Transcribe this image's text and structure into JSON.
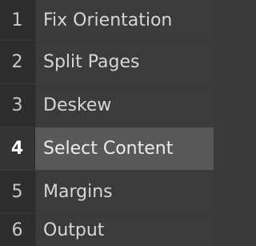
{
  "stages": {
    "selected_index": 3,
    "items": [
      {
        "number": "1",
        "label": "Fix Orientation"
      },
      {
        "number": "2",
        "label": "Split Pages"
      },
      {
        "number": "3",
        "label": "Deskew"
      },
      {
        "number": "4",
        "label": "Select Content"
      },
      {
        "number": "5",
        "label": "Margins"
      },
      {
        "number": "6",
        "label": "Output"
      }
    ]
  },
  "colors": {
    "background": "#3a3a3a",
    "number_column": "#2e2e2e",
    "selected_row": "#585858",
    "text": "#d6d6d6"
  }
}
